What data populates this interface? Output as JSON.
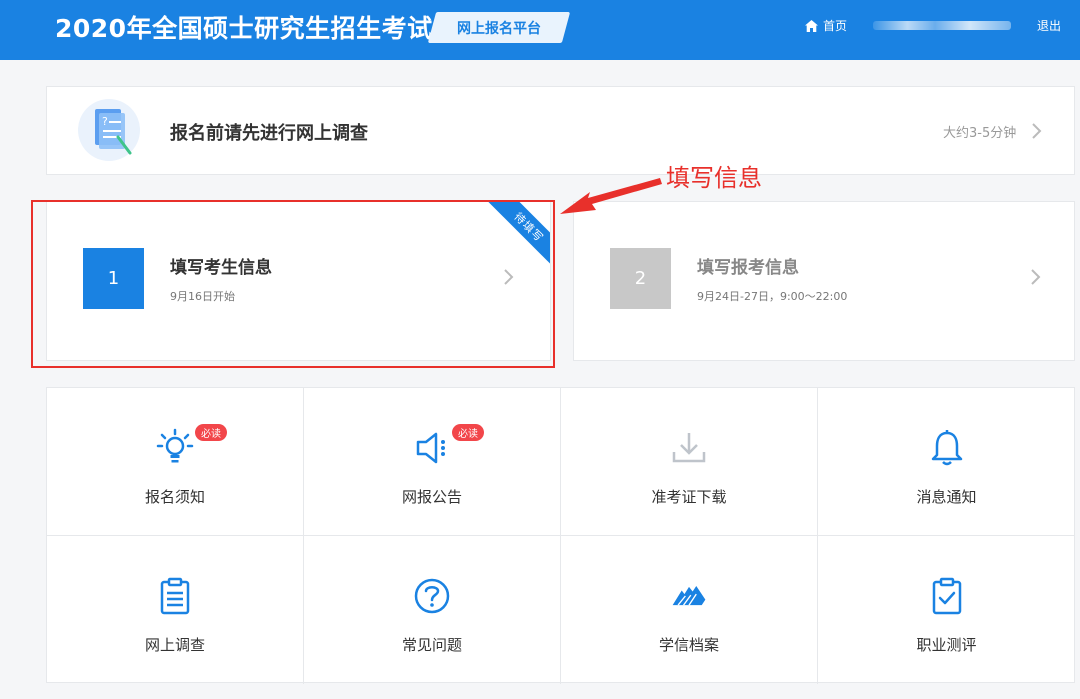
{
  "header": {
    "site_title": "2020年全国硕士研究生招生考试",
    "platform_tag": "网上报名平台",
    "home_label": "首页",
    "logout_label": "退出",
    "accent_color": "#1a82e2"
  },
  "survey": {
    "title": "报名前请先进行网上调查",
    "time_hint": "大约3-5分钟",
    "icon": "survey-document-icon"
  },
  "steps": [
    {
      "number": "1",
      "title": "填写考生信息",
      "subtitle": "9月16日开始",
      "ribbon": "待填写",
      "active": true
    },
    {
      "number": "2",
      "title": "填写报考信息",
      "subtitle": "9月24日-27日，9:00～22:00",
      "active": false
    }
  ],
  "annotation": {
    "callout_text": "填写信息",
    "color": "#e8302b"
  },
  "grid_items": [
    {
      "label": "报名须知",
      "icon": "lightbulb-icon",
      "badge": "必读"
    },
    {
      "label": "网报公告",
      "icon": "megaphone-icon",
      "badge": "必读"
    },
    {
      "label": "准考证下载",
      "icon": "download-icon"
    },
    {
      "label": "消息通知",
      "icon": "bell-icon"
    },
    {
      "label": "网上调查",
      "icon": "clipboard-icon"
    },
    {
      "label": "常见问题",
      "icon": "question-icon"
    },
    {
      "label": "学信档案",
      "icon": "archive-icon"
    },
    {
      "label": "职业测评",
      "icon": "checklist-icon"
    }
  ]
}
